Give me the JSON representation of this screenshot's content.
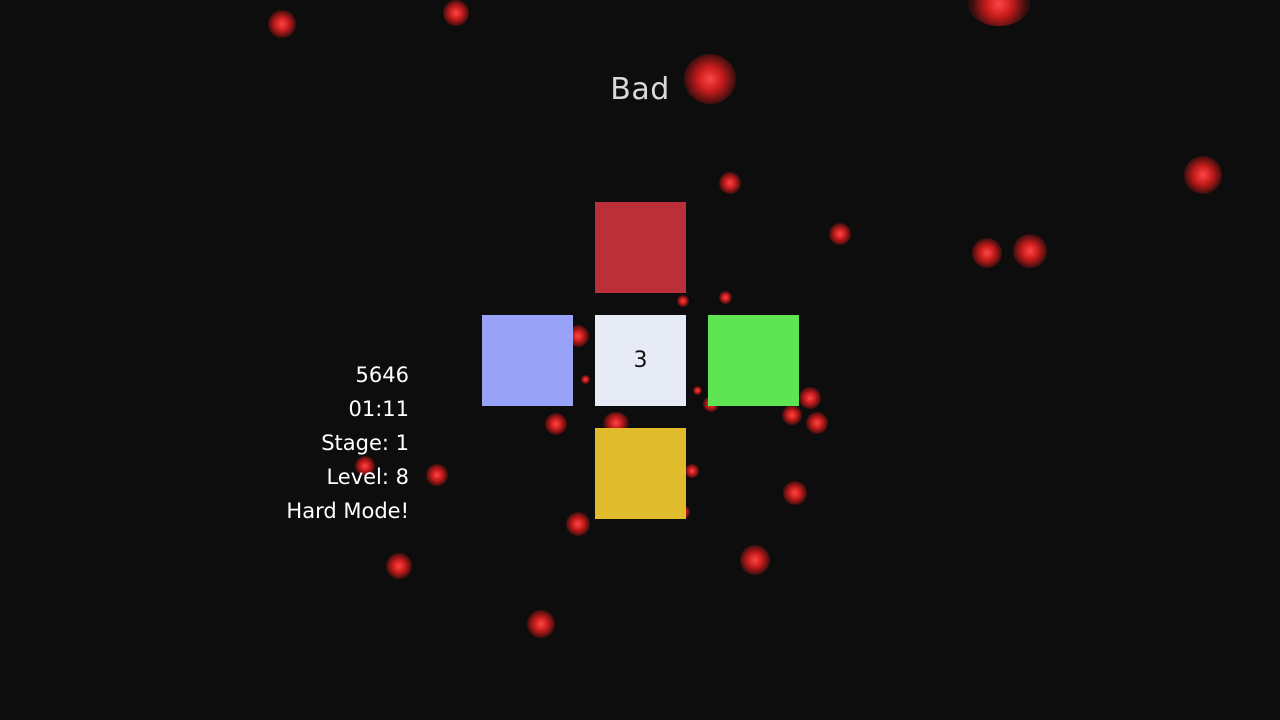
{
  "feedback": {
    "text": "Bad"
  },
  "tiles": {
    "up": {
      "color": "#bb3038"
    },
    "left": {
      "color": "#98a2f6"
    },
    "center": {
      "color": "#e6ebf6",
      "label": "3"
    },
    "right": {
      "color": "#5fe453"
    },
    "down": {
      "color": "#e0bb2b"
    }
  },
  "stats": {
    "score": "5646",
    "time": "01:11",
    "stage": "Stage: 1",
    "level": "Level: 8",
    "mode": "Hard Mode!"
  },
  "particle_color": "#e32a2a"
}
